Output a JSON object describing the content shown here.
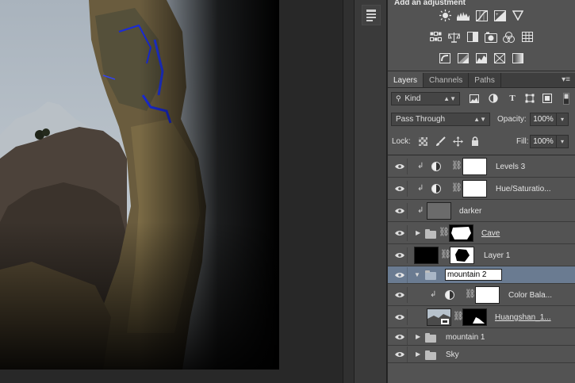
{
  "adjustments": {
    "title": "Add an adjustment",
    "row1": [
      "brightness-contrast-icon",
      "levels-icon",
      "curves-icon",
      "exposure-icon",
      "vibrance-icon"
    ],
    "row2": [
      "hue-saturation-icon",
      "color-balance-icon",
      "black-white-icon",
      "photo-filter-icon",
      "channel-mixer-icon",
      "color-lookup-icon"
    ],
    "row3": [
      "invert-icon",
      "posterize-icon",
      "threshold-icon",
      "selective-color-icon",
      "gradient-map-icon"
    ]
  },
  "tabs": [
    {
      "label": "Layers",
      "active": true
    },
    {
      "label": "Channels",
      "active": false
    },
    {
      "label": "Paths",
      "active": false
    }
  ],
  "filter": {
    "kind_label": "Kind"
  },
  "blend": {
    "mode": "Pass Through",
    "opacity_label": "Opacity:",
    "opacity_value": "100%",
    "lock_label": "Lock:",
    "fill_label": "Fill:",
    "fill_value": "100%"
  },
  "layers": [
    {
      "name": "Levels 3",
      "type": "adjustment",
      "clipped": true
    },
    {
      "name": "Hue/Saturatio...",
      "type": "adjustment",
      "clipped": true
    },
    {
      "name": "darker",
      "type": "pixel",
      "clipped": true
    },
    {
      "name": "Cave",
      "type": "group",
      "collapsed": true,
      "underline": true
    },
    {
      "name": "Layer 1",
      "type": "masked-pixel"
    },
    {
      "name": "mountain 2",
      "type": "group",
      "expanded": true,
      "selected": true,
      "editing": true
    },
    {
      "name": "Color Bala...",
      "type": "adjustment",
      "clipped": true
    },
    {
      "name": "Huangshan_1...",
      "type": "masked-pixel",
      "underline": true
    },
    {
      "name": "mountain 1",
      "type": "group",
      "collapsed": true
    },
    {
      "name": "Sky",
      "type": "group",
      "collapsed": true
    }
  ],
  "colors": {
    "panel": "#535353",
    "selected_row": "#6a7b91",
    "tab_bar": "#3e3e3e"
  }
}
